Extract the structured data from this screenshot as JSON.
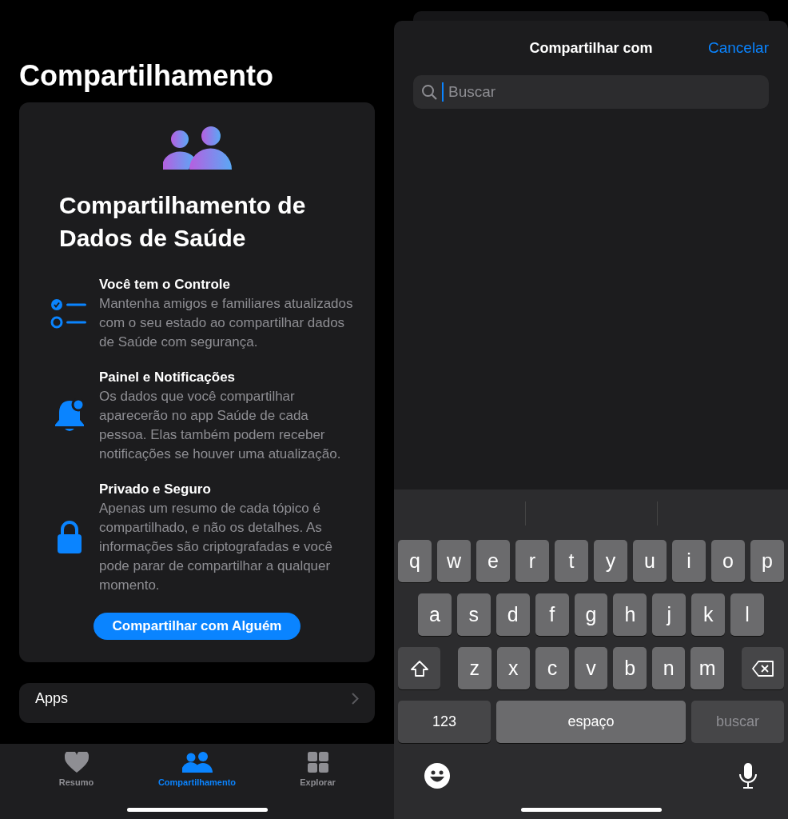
{
  "left": {
    "title": "Compartilhamento",
    "card": {
      "heading": "Compartilhamento de Dados de Saúde",
      "features": [
        {
          "kind": "checklist",
          "title": "Você tem o Controle",
          "text": "Mantenha amigos e familiares atualizados com o seu estado ao compartilhar dados de Saúde com segurança."
        },
        {
          "kind": "bell",
          "title": "Painel e Notificações",
          "text": "Os dados que você compartilhar aparecerão no app Saúde de cada pessoa. Elas também podem receber notificações se houver uma atualização."
        },
        {
          "kind": "lock",
          "title": "Privado e Seguro",
          "text": "Apenas um resumo de cada tópico é compartilhado, e não os detalhes. As informações são criptografadas e você pode parar de compartilhar a qualquer momento."
        }
      ],
      "button": "Compartilhar com Alguém"
    },
    "apps_row": {
      "label": "Apps"
    },
    "tab_bar": {
      "tabs": [
        {
          "kind": "heart",
          "label": "Resumo",
          "selected": false
        },
        {
          "kind": "people",
          "label": "Compartilhamento",
          "selected": true
        },
        {
          "kind": "grid",
          "label": "Explorar",
          "selected": false
        }
      ]
    }
  },
  "right": {
    "sheet": {
      "title": "Compartilhar com",
      "cancel": "Cancelar"
    },
    "search": {
      "placeholder": "Buscar"
    },
    "keyboard": {
      "rows": [
        [
          "q",
          "w",
          "e",
          "r",
          "t",
          "y",
          "u",
          "i",
          "o",
          "p"
        ],
        [
          "a",
          "s",
          "d",
          "f",
          "g",
          "h",
          "j",
          "k",
          "l"
        ],
        [
          "z",
          "x",
          "c",
          "v",
          "b",
          "n",
          "m"
        ]
      ],
      "numbers": "123",
      "space": "espaço",
      "action": "buscar",
      "action_disabled": true
    }
  }
}
